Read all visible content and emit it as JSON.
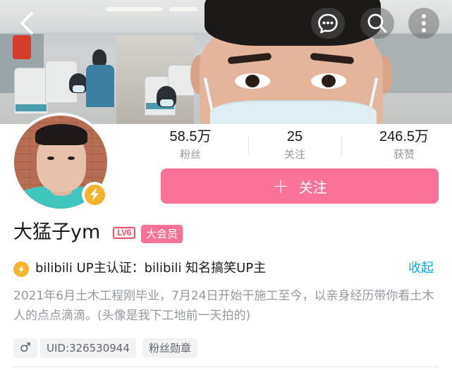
{
  "header": {
    "back_icon": "chevron-left-icon",
    "message_icon": "chat-bubble-icon",
    "search_icon": "search-icon",
    "more_icon": "vertical-dots-icon"
  },
  "stats": [
    {
      "value": "58.5万",
      "label": "粉丝"
    },
    {
      "value": "25",
      "label": "关注"
    },
    {
      "value": "246.5万",
      "label": "获赞"
    }
  ],
  "follow_button": {
    "plus": "+",
    "label": "关注"
  },
  "profile": {
    "name": "大猛子ym",
    "level": "LV6",
    "vip": "大会员"
  },
  "certification": {
    "text": "bilibili UP主认证：bilibili 知名搞笑UP主",
    "collapse": "收起"
  },
  "bio": "2021年6月土木工程刚毕业，7月24日开始干施工至今，以亲身经历带你看土木人的点点滴滴。(头像是我下工地前一天拍的)",
  "tags": {
    "gender": "♂",
    "uid": "UID:326530944",
    "medal": "粉丝勋章"
  },
  "colors": {
    "brand_pink": "#fb7299",
    "link_blue": "#00aeec",
    "badge_gold": "#f6b22d",
    "level_red": "#f34e67"
  }
}
